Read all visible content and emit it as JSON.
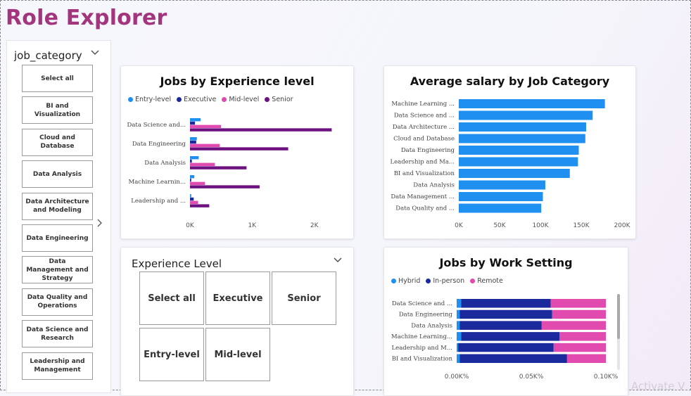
{
  "page_title": "Role Explorer",
  "job_slicer": {
    "header": "job_category",
    "items": [
      "Select all",
      "BI and Visualization",
      "Cloud and Database",
      "Data Analysis",
      "Data Architecture and Modeling",
      "Data Engineering",
      "Data Management and Strategy",
      "Data Quality and Operations",
      "Data Science and Research",
      "Leadership and Management"
    ]
  },
  "exp_slicer": {
    "header": "Experience Level",
    "items": [
      "Select all",
      "Executive",
      "Senior",
      "Entry-level",
      "Mid-level"
    ]
  },
  "watermark": "Activate V",
  "colors": {
    "entry": "#1f8ff0",
    "executive": "#1a2a9c",
    "mid": "#e14aae",
    "senior": "#6d1180",
    "salary": "#1f8ff0",
    "hybrid": "#1f8ff0",
    "inperson": "#1a2a9c",
    "remote": "#e14aae",
    "title": "#a3357e"
  },
  "chart_data": [
    {
      "type": "bar",
      "title": "Jobs by Experience level",
      "orientation": "horizontal",
      "categories": [
        "Data Science and...",
        "Data Engineering",
        "Data Analysis",
        "Machine Learnin...",
        "Leadership and ..."
      ],
      "series": [
        {
          "name": "Entry-level",
          "values": [
            170,
            110,
            140,
            70,
            20
          ]
        },
        {
          "name": "Executive",
          "values": [
            80,
            100,
            30,
            20,
            60
          ]
        },
        {
          "name": "Mid-level",
          "values": [
            500,
            480,
            400,
            240,
            130
          ]
        },
        {
          "name": "Senior",
          "values": [
            2280,
            1580,
            910,
            1120,
            310
          ]
        }
      ],
      "xlim": [
        0,
        2400
      ],
      "xticks": [
        {
          "v": 0,
          "label": "0K"
        },
        {
          "v": 1000,
          "label": "1K"
        },
        {
          "v": 2000,
          "label": "2K"
        }
      ]
    },
    {
      "type": "bar",
      "title": "Average salary by Job Category",
      "orientation": "horizontal",
      "categories": [
        "Machine Learning ...",
        "Data Science and ...",
        "Data Architecture ...",
        "Cloud and Database",
        "Data Engineering",
        "Leadership and Ma...",
        "BI and Visualization",
        "Data Analysis",
        "Data Management ...",
        "Data Quality and ..."
      ],
      "values": [
        179000,
        164000,
        156000,
        155000,
        147000,
        146000,
        136000,
        106000,
        103000,
        101000
      ],
      "xlim": [
        0,
        200000
      ],
      "xticks": [
        {
          "v": 0,
          "label": "0K"
        },
        {
          "v": 50000,
          "label": "50K"
        },
        {
          "v": 100000,
          "label": "100K"
        },
        {
          "v": 150000,
          "label": "150K"
        },
        {
          "v": 200000,
          "label": "200K"
        }
      ]
    },
    {
      "type": "bar",
      "title": "Jobs by Work Setting",
      "orientation": "horizontal",
      "stacked": "percent",
      "categories": [
        "Data Science and ...",
        "Data Engineering",
        "Data Analysis",
        "Machine Learning...",
        "Leadership and M...",
        "BI and Visualization"
      ],
      "series": [
        {
          "name": "Hybrid",
          "values": [
            3,
            2,
            2,
            3,
            1,
            2
          ]
        },
        {
          "name": "In-person",
          "values": [
            60,
            62,
            55,
            66,
            64,
            72
          ]
        },
        {
          "name": "Remote",
          "values": [
            37,
            36,
            43,
            31,
            35,
            26
          ]
        }
      ],
      "xticks": [
        {
          "v": 0,
          "label": "0.00K%"
        },
        {
          "v": 50,
          "label": "0.05K%"
        },
        {
          "v": 100,
          "label": "0.10K%"
        }
      ]
    }
  ]
}
